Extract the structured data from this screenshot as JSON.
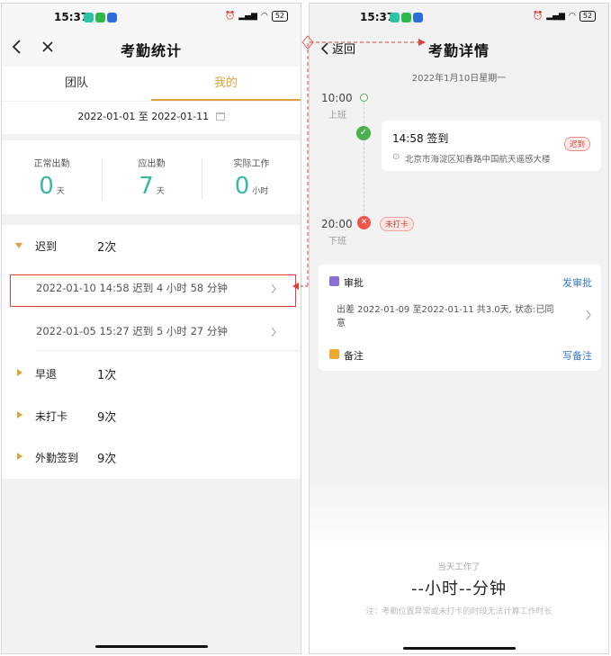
{
  "left": {
    "status": {
      "time": "15:37",
      "battery": "52",
      "signal": "HD"
    },
    "title": "考勤统计",
    "tabs": [
      {
        "label": "团队"
      },
      {
        "label": "我的"
      }
    ],
    "date_range": "2022-01-01 至 2022-01-11",
    "stats": [
      {
        "label": "正常出勤",
        "value": "0",
        "unit": "天"
      },
      {
        "label": "应出勤",
        "value": "7",
        "unit": "天"
      },
      {
        "label": "实际工作",
        "value": "0",
        "unit": "小时"
      }
    ],
    "categories": [
      {
        "name": "迟到",
        "count": "2次"
      },
      {
        "name": "早退",
        "count": "1次"
      },
      {
        "name": "未打卡",
        "count": "9次"
      },
      {
        "name": "外勤签到",
        "count": "9次"
      }
    ],
    "late_records": [
      "2022-01-10 14:58 迟到 4 小时 58 分钟",
      "2022-01-05 15:27 迟到 5 小时 27 分钟"
    ],
    "colors": {
      "accent": "#e0a23b",
      "stat_value": "#39b8a5",
      "highlight": "#e0403a"
    }
  },
  "right": {
    "status": {
      "time": "15:37",
      "battery": "52",
      "signal": "HD"
    },
    "back_label": "返回",
    "title": "考勤详情",
    "date": "2022年1月10日星期一",
    "timeline": [
      {
        "time": "10:00",
        "label": "上班"
      },
      {
        "time": "20:00",
        "label": "下班"
      }
    ],
    "checkin": {
      "text": "14:58 签到",
      "tag": "迟到",
      "location": "北京市海淀区知春路中国航天遥感大楼"
    },
    "missed_tag": "未打卡",
    "approval": {
      "title": "审批",
      "action": "发审批",
      "detail_line1": "出差 2022-01-09 至2022-01-11 共3.0天, 状态:已同",
      "detail_line2": "意"
    },
    "remark": {
      "title": "备注",
      "action": "写备注"
    },
    "work_today_label": "当天工作了",
    "work_today_value": "--小时--分钟",
    "note": "注：考勤位置异常或未打卡的时段无法计算工作时长",
    "colors": {
      "green": "#4caf50",
      "red": "#f0544a",
      "link": "#3a7bd5"
    }
  }
}
